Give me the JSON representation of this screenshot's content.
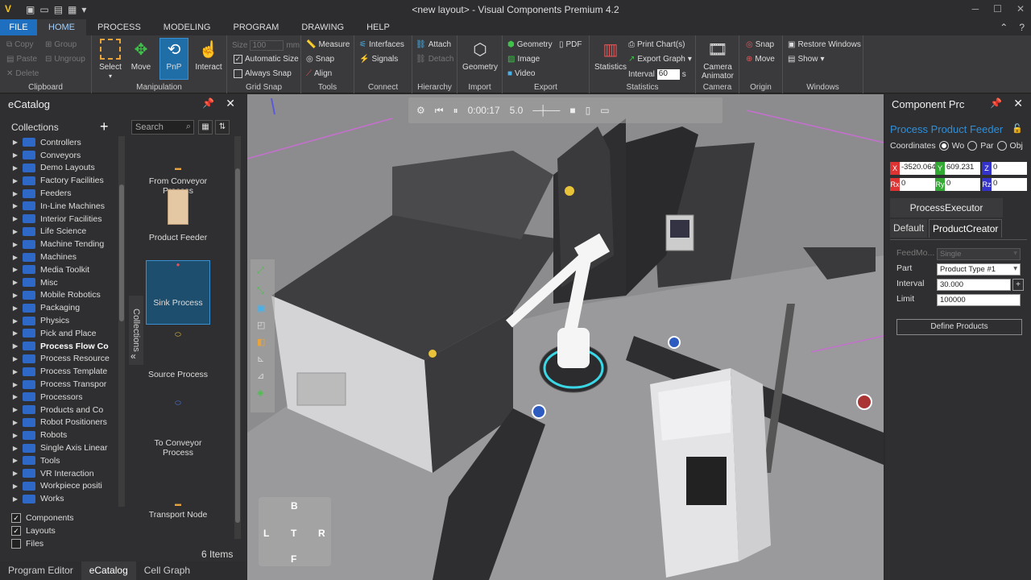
{
  "window": {
    "title": "<new layout> - Visual Components Premium 4.2"
  },
  "menu": {
    "file": "FILE",
    "home": "HOME",
    "process": "PROCESS",
    "modeling": "MODELING",
    "program": "PROGRAM",
    "drawing": "DRAWING",
    "help": "HELP"
  },
  "ribbon": {
    "clipboard": {
      "label": "Clipboard",
      "copy": "Copy",
      "paste": "Paste",
      "delete": "Delete",
      "group": "Group",
      "ungroup": "Ungroup"
    },
    "manipulation": {
      "label": "Manipulation",
      "select": "Select",
      "move": "Move",
      "pnp": "PnP",
      "interact": "Interact"
    },
    "gridsnap": {
      "label": "Grid Snap",
      "size": "Size",
      "size_value": "100",
      "size_unit": "mm",
      "auto_size": "Automatic Size",
      "always_snap": "Always Snap"
    },
    "tools": {
      "label": "Tools",
      "measure": "Measure",
      "snap": "Snap",
      "align": "Align"
    },
    "connect": {
      "label": "Connect",
      "interfaces": "Interfaces",
      "signals": "Signals"
    },
    "hierarchy": {
      "label": "Hierarchy",
      "attach": "Attach",
      "detach": "Detach"
    },
    "import": {
      "label": "Import",
      "geometry": "Geometry"
    },
    "export": {
      "label": "Export",
      "geometry": "Geometry",
      "image": "Image",
      "video": "Video",
      "pdf": "PDF"
    },
    "statistics": {
      "label": "Statistics",
      "statistics": "Statistics",
      "print_charts": "Print Chart(s)",
      "export_graph": "Export Graph",
      "interval": "Interval",
      "interval_value": "60",
      "interval_unit": "s"
    },
    "camera": {
      "label": "Camera",
      "animator": "Camera Animator"
    },
    "origin": {
      "label": "Origin",
      "snap": "Snap",
      "move": "Move"
    },
    "windows": {
      "label": "Windows",
      "restore": "Restore Windows",
      "show": "Show"
    }
  },
  "ecatalog": {
    "title": "eCatalog",
    "collections_label": "Collections",
    "search_placeholder": "Search",
    "side_tab": "Collections",
    "tree": [
      "Controllers",
      "Conveyors",
      "Demo Layouts",
      "Factory Facilities",
      "Feeders",
      "In-Line Machines",
      "Interior Facilities",
      "Life Science",
      "Machine Tending",
      "Machines",
      "Media Toolkit",
      "Misc",
      "Mobile Robotics",
      "Packaging",
      "Physics",
      "Pick and Place",
      "Process Flow Co",
      "Process Resource",
      "Process Template",
      "Process Transpor",
      "Processors",
      "Products and Co",
      "Robot Positioners",
      "Robots",
      "Single Axis Linear",
      "Tools",
      "VR Interaction",
      "Workpiece positi",
      "Works"
    ],
    "items": [
      "From Conveyor Process",
      "Product Feeder",
      "Sink Process",
      "Source Process",
      "To Conveyor Process",
      "Transport Node"
    ],
    "item_count": "6 Items",
    "filters": [
      {
        "label": "Components",
        "checked": true
      },
      {
        "label": "Layouts",
        "checked": true
      },
      {
        "label": "Files",
        "checked": false
      }
    ]
  },
  "bottom_tabs": [
    "Program Editor",
    "eCatalog",
    "Cell Graph"
  ],
  "viewport": {
    "time": "0:00:17",
    "speed": "5.0",
    "nav": {
      "b": "B",
      "l": "L",
      "t": "T",
      "r": "R",
      "f": "F"
    }
  },
  "properties": {
    "title": "Component Prc",
    "component_name": "Process Product Feeder",
    "coordinates_label": "Coordinates",
    "coord_options": [
      "Wo",
      "Par",
      "Obj"
    ],
    "x": "-3520.064",
    "y": "609.231",
    "z": "0",
    "rx": "0",
    "ry": "0",
    "rz": "0",
    "executor": "ProcessExecutor",
    "tabs": [
      "Default",
      "ProductCreator"
    ],
    "feed_mode_label": "FeedMo...",
    "feed_mode_value": "Single",
    "part_label": "Part",
    "part_value": "Product Type #1",
    "interval_label": "Interval",
    "interval_value": "30.000",
    "limit_label": "Limit",
    "limit_value": "100000",
    "define_button": "Define Products"
  }
}
